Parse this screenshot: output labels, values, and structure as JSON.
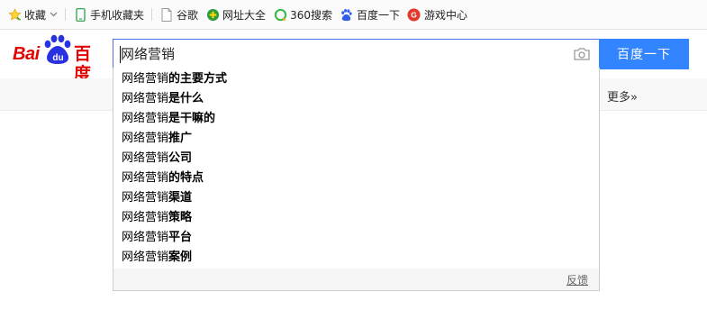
{
  "bookmarks": [
    {
      "label": "收藏",
      "icon": "star-icon"
    },
    {
      "label": "手机收藏夹",
      "icon": "phone-icon"
    },
    {
      "label": "谷歌",
      "icon": "page-icon"
    },
    {
      "label": "网址大全",
      "icon": "globe-plus-icon"
    },
    {
      "label": "360搜索",
      "icon": "search360-icon"
    },
    {
      "label": "百度一下",
      "icon": "baidu-paw-icon"
    },
    {
      "label": "游戏中心",
      "icon": "game-icon"
    }
  ],
  "logo": {
    "latin": "Bai",
    "badge": "du",
    "chinese": "百度"
  },
  "search": {
    "value": "网络营销",
    "button_label": "百度一下"
  },
  "nav": {
    "more_label": "更多»"
  },
  "suggestions": [
    {
      "query": "网络营销",
      "rest": "的主要方式"
    },
    {
      "query": "网络营销",
      "rest": "是什么"
    },
    {
      "query": "网络营销",
      "rest": "是干嘛的"
    },
    {
      "query": "网络营销",
      "rest": "推广"
    },
    {
      "query": "网络营销",
      "rest": "公司"
    },
    {
      "query": "网络营销",
      "rest": "的特点"
    },
    {
      "query": "网络营销",
      "rest": "渠道"
    },
    {
      "query": "网络营销",
      "rest": "策略"
    },
    {
      "query": "网络营销",
      "rest": "平台"
    },
    {
      "query": "网络营销",
      "rest": "案例"
    }
  ],
  "suggest_footer": {
    "feedback_label": "反馈"
  },
  "colors": {
    "brand_red": "#e10602",
    "brand_blue": "#2932e1",
    "button_blue": "#3385ff",
    "input_border": "#4e6ef2"
  }
}
